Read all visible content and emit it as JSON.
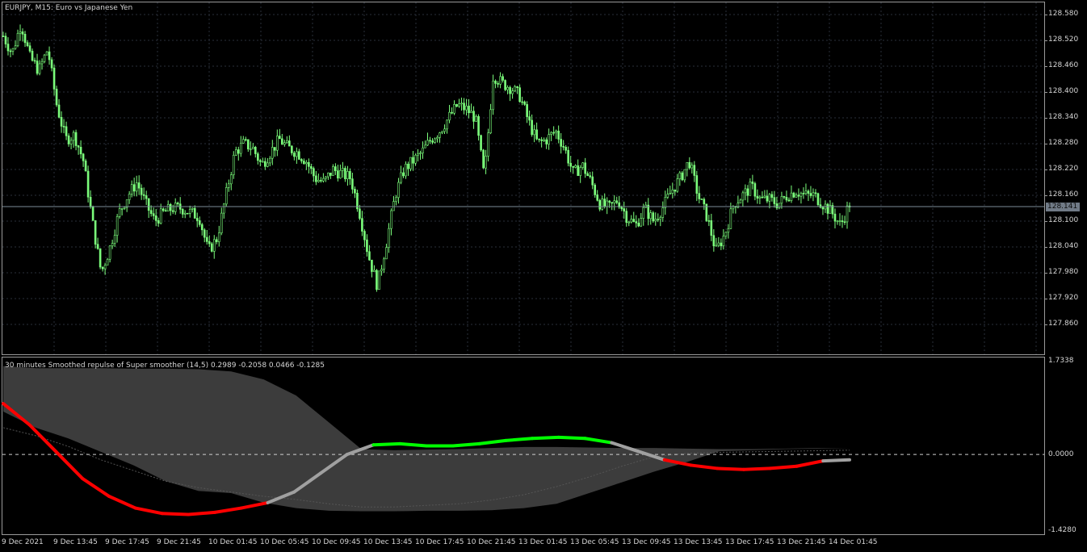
{
  "chart_title": "EURJPY, M15:  Euro vs Japanese Yen",
  "indicator_title": "30 minutes Smoothed repulse of Super smoother (14,5) 0.2989 -0.2058 0.0466 -0.1285",
  "current_price": "128.141",
  "colors": {
    "background": "#000000",
    "candle": "#7cff7c",
    "grid": "#2a2f3a",
    "band": "#3c3c3c",
    "rising": "#00ff00",
    "falling": "#ff0000",
    "neutral": "#a0a0a0",
    "bid_line": "#7d8c99"
  },
  "price_axis": [
    "128.580",
    "128.520",
    "128.460",
    "128.400",
    "128.340",
    "128.280",
    "128.220",
    "128.160",
    "128.100",
    "128.040",
    "127.980",
    "127.920",
    "127.860"
  ],
  "indicator_axis": [
    "1.7338",
    "0.0000",
    "-1.4280"
  ],
  "time_axis": [
    "9 Dec 2021",
    "9 Dec 13:45",
    "9 Dec 17:45",
    "9 Dec 21:45",
    "10 Dec 01:45",
    "10 Dec 05:45",
    "10 Dec 09:45",
    "10 Dec 13:45",
    "10 Dec 17:45",
    "10 Dec 21:45",
    "13 Dec 01:45",
    "13 Dec 05:45",
    "13 Dec 09:45",
    "13 Dec 13:45",
    "13 Dec 17:45",
    "13 Dec 21:45",
    "14 Dec 01:45"
  ],
  "chart_data": {
    "type": "line",
    "symbol": "EURJPY",
    "timeframe": "M15",
    "price_ylim": [
      127.82,
      128.6
    ],
    "price_path": [
      128.53,
      128.49,
      128.56,
      128.48,
      128.45,
      128.5,
      128.37,
      128.29,
      128.3,
      128.24,
      128.1,
      127.98,
      128.04,
      128.12,
      128.16,
      128.19,
      128.14,
      128.1,
      128.12,
      128.13,
      128.13,
      128.12,
      128.11,
      128.03,
      128.06,
      128.16,
      128.26,
      128.28,
      128.27,
      128.23,
      128.26,
      128.29,
      128.27,
      128.26,
      128.24,
      128.2,
      128.19,
      128.22,
      128.21,
      128.2,
      128.12,
      128.02,
      127.95,
      128.05,
      128.16,
      128.22,
      128.24,
      128.26,
      128.29,
      128.31,
      128.34,
      128.37,
      128.36,
      128.34,
      128.2,
      128.44,
      128.42,
      128.41,
      128.39,
      128.33,
      128.28,
      128.29,
      128.31,
      128.27,
      128.21,
      128.23,
      128.19,
      128.14,
      128.13,
      128.15,
      128.11,
      128.09,
      128.13,
      128.1,
      128.13,
      128.17,
      128.2,
      128.24,
      128.16,
      128.11,
      128.03,
      128.07,
      128.14,
      128.16,
      128.18,
      128.15,
      128.15,
      128.14,
      128.16,
      128.17,
      128.16,
      128.16,
      128.14,
      128.12,
      128.09,
      128.14
    ],
    "indicator_ylim": [
      -1.428,
      1.7338
    ],
    "band_upper": [
      1.65,
      1.61,
      1.61,
      1.61,
      1.6,
      1.6,
      1.59,
      1.55,
      1.4,
      1.1,
      0.6,
      0.1,
      0.08,
      0.09,
      0.1,
      0.12,
      0.14,
      0.14,
      0.13,
      0.12,
      0.12,
      0.11,
      0.1,
      0.1,
      0.11,
      0.12,
      0.12
    ],
    "band_lower": [
      0.8,
      0.5,
      0.3,
      0.05,
      -0.2,
      -0.5,
      -0.68,
      -0.72,
      -0.9,
      -1.0,
      -1.05,
      -1.06,
      -1.06,
      -1.05,
      -1.05,
      -1.04,
      -1.0,
      -0.92,
      -0.72,
      -0.52,
      -0.32,
      -0.14,
      0.06,
      0.08,
      0.1,
      0.11,
      0.12
    ],
    "band_mid": [
      0.5,
      0.35,
      0.15,
      -0.1,
      -0.3,
      -0.5,
      -0.62,
      -0.7,
      -0.78,
      -0.84,
      -0.92,
      -0.98,
      -0.98,
      -0.95,
      -0.92,
      -0.85,
      -0.75,
      -0.6,
      -0.42,
      -0.22,
      -0.04,
      0.02,
      0.04,
      0.05,
      0.06,
      0.07,
      0.08
    ],
    "repulse": [
      0.95,
      0.55,
      0.05,
      -0.45,
      -0.78,
      -1.0,
      -1.1,
      -1.12,
      -1.08,
      -1.0,
      -0.9,
      -0.7,
      -0.35,
      0.0,
      0.18,
      0.2,
      0.16,
      0.16,
      0.2,
      0.26,
      0.3,
      0.32,
      0.3,
      0.22,
      0.06,
      -0.1,
      -0.2,
      -0.26,
      -0.28,
      -0.26,
      -0.22,
      -0.12,
      -0.1
    ],
    "repulse_state": [
      "falling",
      "falling",
      "falling",
      "falling",
      "falling",
      "falling",
      "falling",
      "falling",
      "falling",
      "falling",
      "neutral",
      "neutral",
      "neutral",
      "neutral",
      "rising",
      "rising",
      "rising",
      "rising",
      "rising",
      "rising",
      "rising",
      "rising",
      "rising",
      "neutral",
      "neutral",
      "falling",
      "falling",
      "falling",
      "falling",
      "falling",
      "falling",
      "neutral",
      "neutral"
    ]
  }
}
